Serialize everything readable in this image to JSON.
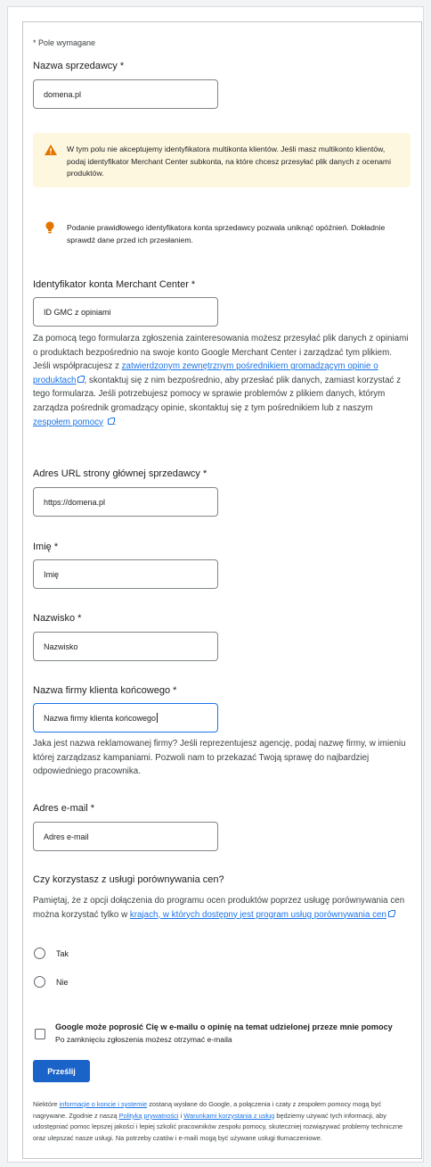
{
  "required_note": "* Pole wymagane",
  "seller_name": {
    "label": "Nazwa sprzedawcy *",
    "value": "domena.pl"
  },
  "warning": {
    "icon": "warning-icon",
    "text": "W tym polu nie akceptujemy identyfikatora multikonta klientów. Jeśli masz multikonto klientów, podaj identyfikator Merchant Center subkonta, na które chcesz przesyłać plik danych z ocenami produktów."
  },
  "tip": {
    "icon": "lightbulb-icon",
    "text": "Podanie prawidłowego identyfikatora konta sprzedawcy pozwala uniknąć opóźnień. Dokładnie sprawdź dane przed ich przesłaniem."
  },
  "merchant_id": {
    "label": "Identyfikator konta Merchant Center *",
    "placeholder": "ID GMC z opiniami",
    "help_part1": "Za pomocą tego formularza zgłoszenia zainteresowania możesz przesyłać plik danych z opiniami o produktach bezpośrednio na swoje konto Google Merchant Center i zarządzać tym plikiem. Jeśli współpracujesz z ",
    "help_link1": "zatwierdzonym zewnętrznym pośrednikiem gromadzącym opinie o produktach",
    "help_part2": ", skontaktuj się z nim bezpośrednio, aby przesłać plik danych, zamiast korzystać z tego formularza. Jeśli potrzebujesz pomocy w sprawie problemów z plikiem danych, którym zarządza pośrednik gromadzący opinie, skontaktuj się z tym pośrednikiem lub z naszym ",
    "help_link2": "zespołem pomocy",
    "help_part3": "."
  },
  "homepage_url": {
    "label": "Adres URL strony głównej sprzedawcy *",
    "placeholder": "https://domena.pl"
  },
  "first_name": {
    "label": "Imię *",
    "placeholder": "Imię"
  },
  "last_name": {
    "label": "Nazwisko *",
    "placeholder": "Nazwisko"
  },
  "end_client": {
    "label": "Nazwa firmy klienta końcowego *",
    "value": "Nazwa firmy klienta końcowego",
    "help": "Jaka jest nazwa reklamowanej firmy? Jeśli reprezentujesz agencję, podaj nazwę firmy, w imieniu której zarządzasz kampaniami. Pozwoli nam to przekazać Twoją sprawę do najbardziej odpowiedniego pracownika."
  },
  "email": {
    "label": "Adres e-mail *",
    "placeholder": "Adres e-mail"
  },
  "css": {
    "question": "Czy korzystasz z usługi porównywania cen?",
    "help_part1": "Pamiętaj, że z opcji dołączenia do programu ocen produktów poprzez usługę porównywania cen można korzystać tylko w ",
    "help_link": "krajach, w których dostępny jest program usług porównywania cen",
    "options": [
      "Tak",
      "Nie"
    ]
  },
  "consent": {
    "title": "Google może poprosić Cię w e-mailu o opinię na temat udzielonej przeze mnie pomocy",
    "subtitle": "Po zamknięciu zgłoszenia możesz otrzymać e-maila"
  },
  "submit_label": "Prześlij",
  "footer": {
    "part1": "Niektóre ",
    "link1": "informacje o koncie i systemie",
    "part2": " zostaną wysłane do Google, a połączenia i czaty z zespołem pomocy mogą być nagrywane. Zgodnie z naszą ",
    "link2": "Polityką prywatności",
    "part3": " i ",
    "link3": "Warunkami korzystania z usług",
    "part4": " będziemy używać tych informacji, aby udostępniać pomoc lepszej jakości i lepiej szkolić pracowników zespołu pomocy, skuteczniej rozwiązywać problemy techniczne oraz ulepszać nasze usługi. Na potrzeby czatów i e-maili mogą być używane usługi tłumaczeniowe."
  },
  "colors": {
    "accent": "#1a73e8",
    "button": "#1a63c8",
    "warning_bg": "#fef7e0",
    "warning_icon": "#e37400"
  }
}
